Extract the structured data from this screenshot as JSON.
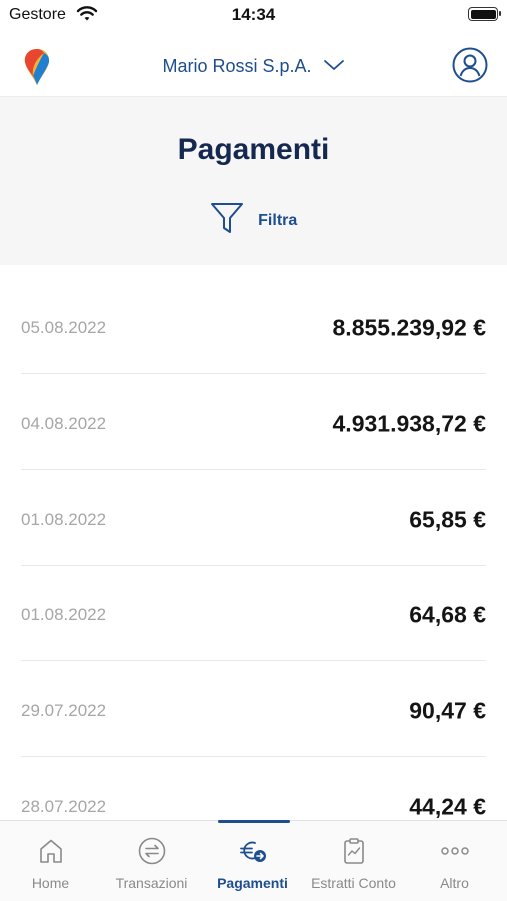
{
  "status_bar": {
    "carrier": "Gestore",
    "time": "14:34"
  },
  "top_nav": {
    "company": "Mario Rossi S.p.A."
  },
  "header": {
    "title": "Pagamenti",
    "filter_label": "Filtra"
  },
  "payments": [
    {
      "date": "05.08.2022",
      "amount": "8.855.239,92 €"
    },
    {
      "date": "04.08.2022",
      "amount": "4.931.938,72 €"
    },
    {
      "date": "01.08.2022",
      "amount": "65,85 €"
    },
    {
      "date": "01.08.2022",
      "amount": "64,68 €"
    },
    {
      "date": "29.07.2022",
      "amount": "90,47 €"
    },
    {
      "date": "28.07.2022",
      "amount": "44,24 €"
    }
  ],
  "tabs": [
    {
      "label": "Home",
      "icon": "home-icon"
    },
    {
      "label": "Transazioni",
      "icon": "transactions-icon"
    },
    {
      "label": "Pagamenti",
      "icon": "euro-payment-icon",
      "active": true
    },
    {
      "label": "Estratti Conto",
      "icon": "clipboard-chart-icon"
    },
    {
      "label": "Altro",
      "icon": "more-dots-icon"
    }
  ],
  "colors": {
    "accent": "#1d4e8f",
    "title": "#142850",
    "muted": "#a6a6a6"
  }
}
